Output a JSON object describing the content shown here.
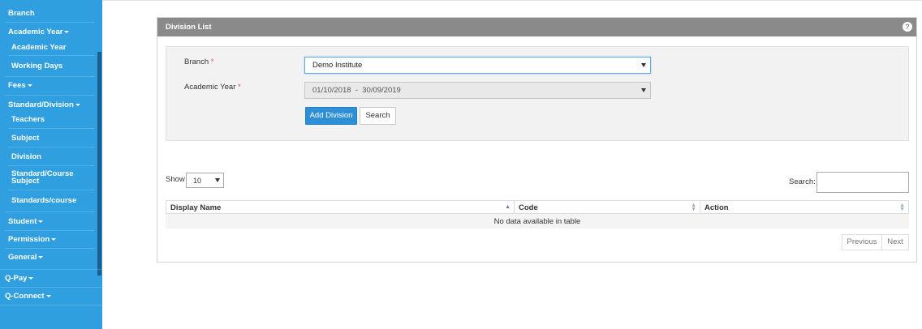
{
  "sidebar": {
    "items": [
      {
        "label": "Branch",
        "dropdown": false
      },
      {
        "label": "Academic Year",
        "dropdown": true
      },
      {
        "label": "Academic Year",
        "dropdown": false
      },
      {
        "label": "Working Days",
        "dropdown": false
      },
      {
        "label": "Fees",
        "dropdown": true
      },
      {
        "label": "Standard/Division",
        "dropdown": true
      },
      {
        "label": "Teachers",
        "dropdown": false
      },
      {
        "label": "Subject",
        "dropdown": false
      },
      {
        "label": "Division",
        "dropdown": false
      },
      {
        "label": "Standard/Course",
        "dropdown": false
      },
      {
        "label": "Subject",
        "dropdown": false
      },
      {
        "label": "Standards/course",
        "dropdown": false
      },
      {
        "label": "Student",
        "dropdown": true
      },
      {
        "label": "Permission",
        "dropdown": true
      },
      {
        "label": "General",
        "dropdown": true
      },
      {
        "label": "Q-Pay",
        "dropdown": true
      },
      {
        "label": "Q-Connect",
        "dropdown": true
      }
    ]
  },
  "panel": {
    "title": "Division List",
    "help": "?"
  },
  "filters": {
    "branch_label": "Branch",
    "branch_value": "Demo Institute",
    "year_label": "Academic Year",
    "year_value": "01/10/2018  -  30/09/2019",
    "required_mark": "*",
    "add_button": "Add Division",
    "search_button": "Search"
  },
  "table": {
    "show_label": "Show",
    "show_value": "10",
    "search_label": "Search:",
    "columns": [
      "Display Name",
      "Code",
      "Action"
    ],
    "empty_message": "No data available in table",
    "prev": "Previous",
    "next": "Next"
  },
  "colors": {
    "sidebar": "#2f9fe0",
    "panel_header": "#8a8a8a",
    "primary_button": "#2f8fd6"
  }
}
